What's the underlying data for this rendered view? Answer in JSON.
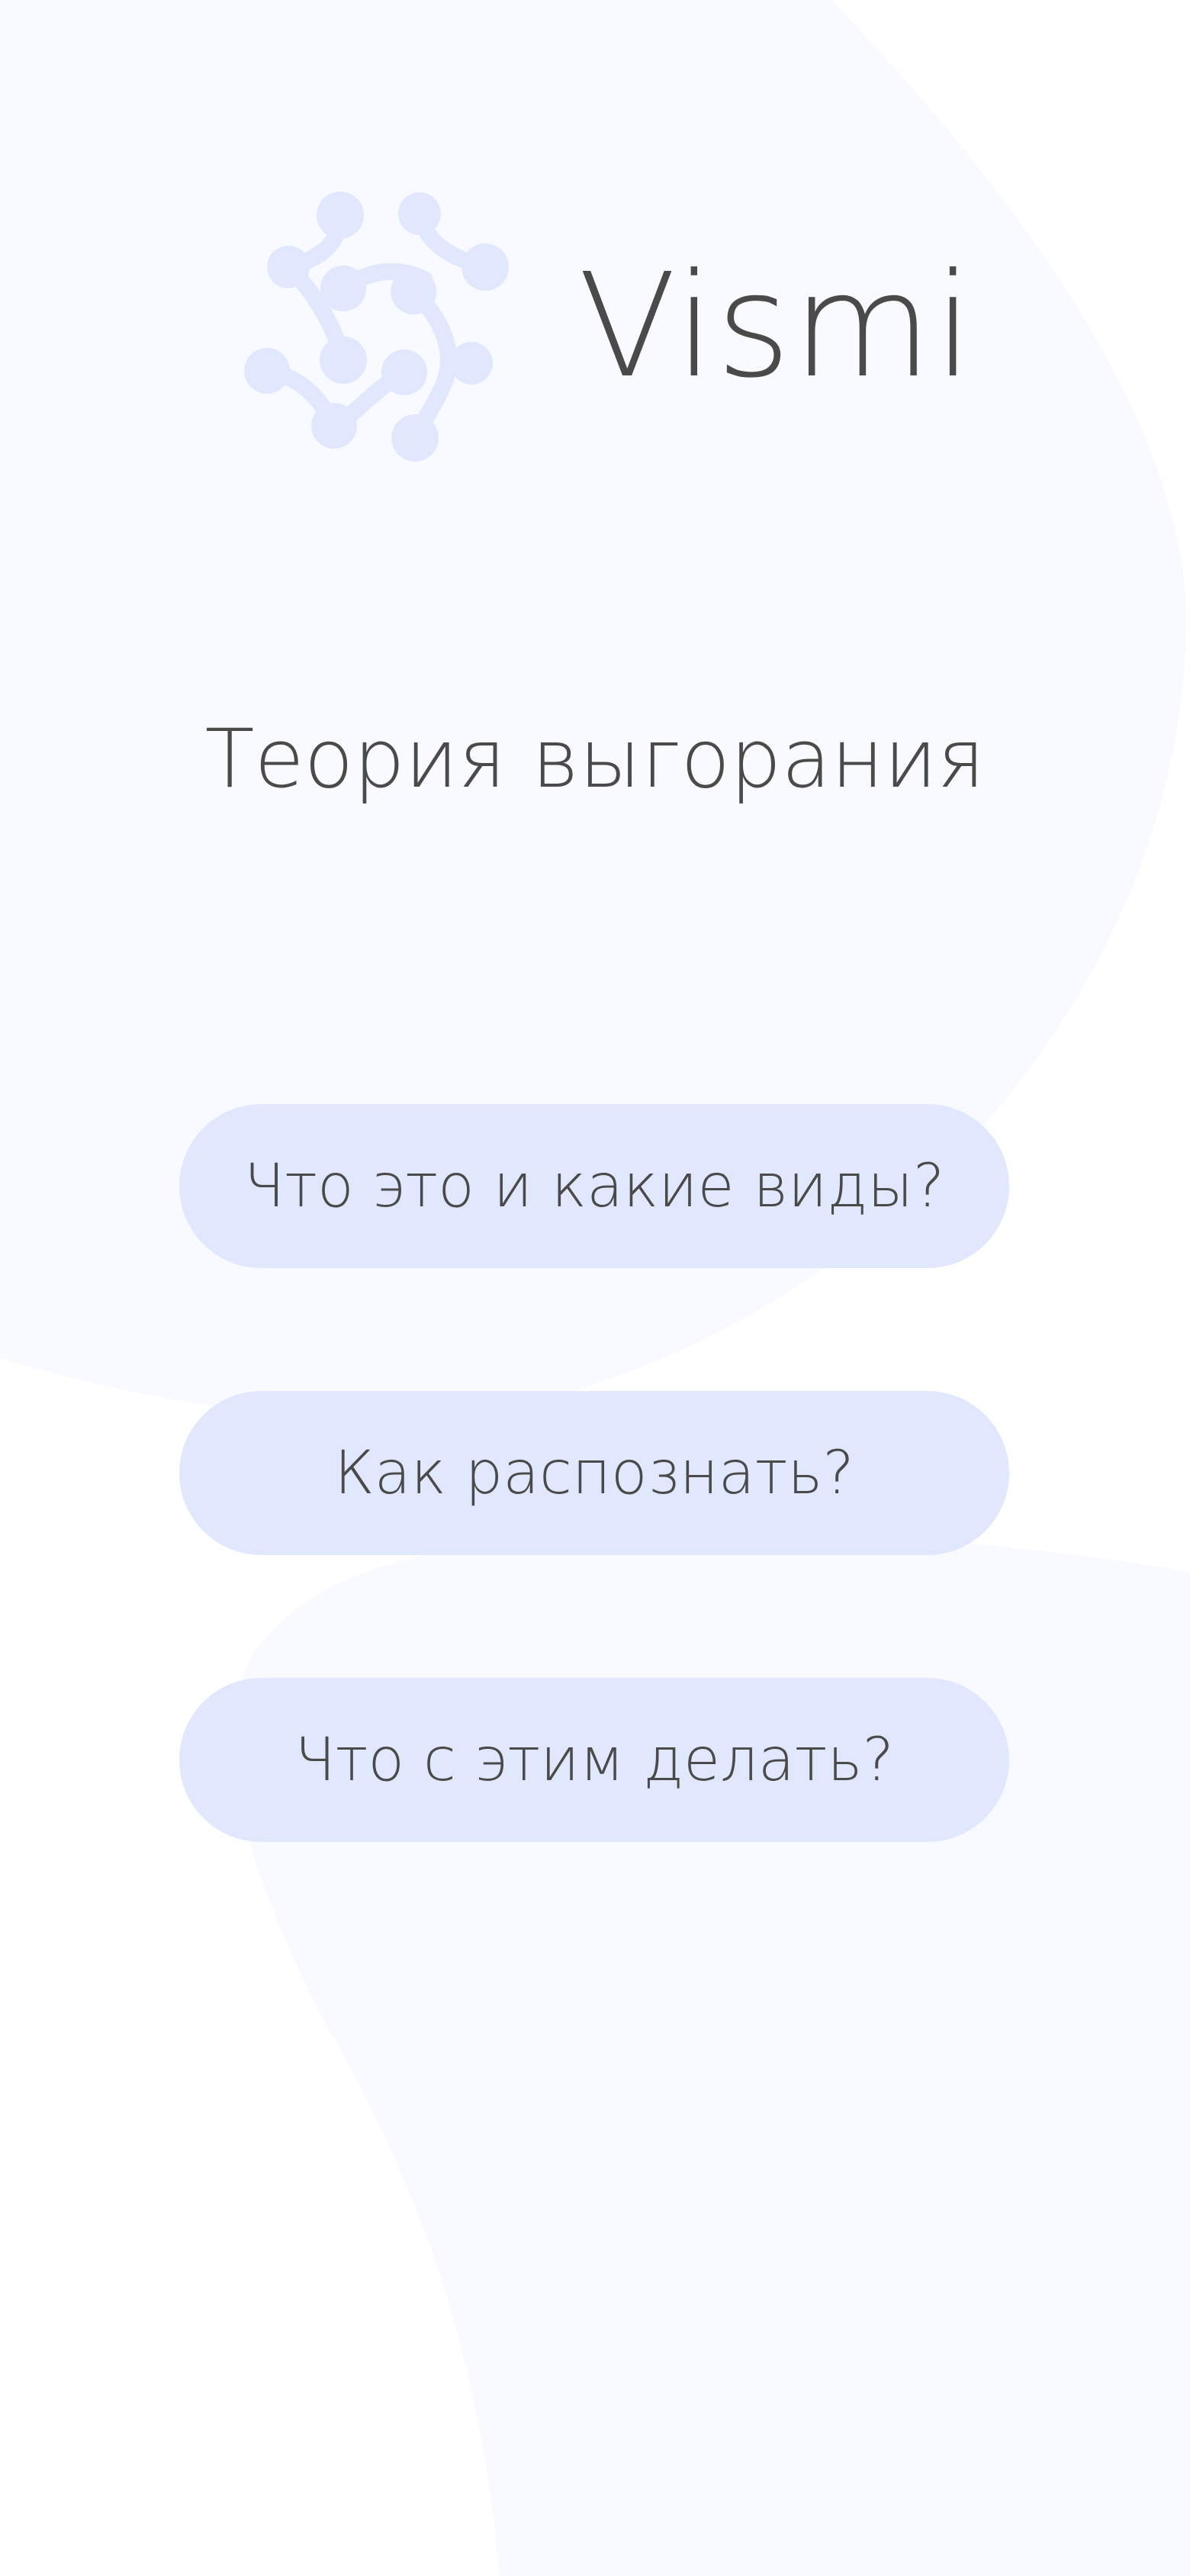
{
  "app": {
    "name": "Vismi",
    "logo_icon": "molecule-knot-icon"
  },
  "page": {
    "title": "Теория выгорания"
  },
  "menu": {
    "items": [
      {
        "label": "Что это и какие виды?"
      },
      {
        "label": "Как распознать?"
      },
      {
        "label": "Что с этим делать?"
      }
    ]
  },
  "colors": {
    "background": "#ffffff",
    "blob": "#f8faff",
    "button": "#e1e8fd",
    "logo_mark": "#e1e8fd",
    "text": "#4a4a4a"
  }
}
